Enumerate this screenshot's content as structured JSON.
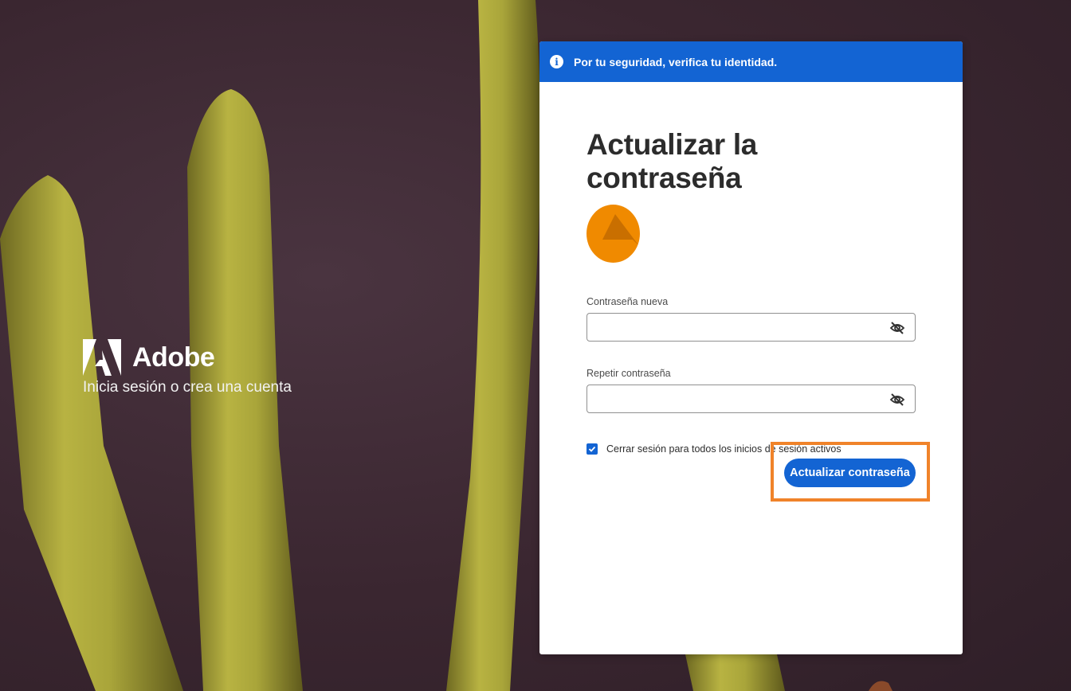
{
  "brand": {
    "name": "Adobe",
    "tagline": "Inicia sesión o crea una cuenta"
  },
  "banner": {
    "icon": "info-icon",
    "text": "Por tu seguridad, verifica tu identidad."
  },
  "form": {
    "title": "Actualizar la contraseña",
    "new_password": {
      "label": "Contraseña nueva",
      "value": "",
      "icon": "eye-slash-icon"
    },
    "repeat_password": {
      "label": "Repetir contraseña",
      "value": "",
      "icon": "eye-slash-icon"
    },
    "logout_all": {
      "label": "Cerrar sesión para todos los inicios de sesión activos",
      "checked": true
    },
    "submit_label": "Actualizar contraseña"
  },
  "colors": {
    "primary": "#1364d3",
    "avatar": "#f08a00",
    "highlight": "#f0832a",
    "background": "#3a2630"
  }
}
